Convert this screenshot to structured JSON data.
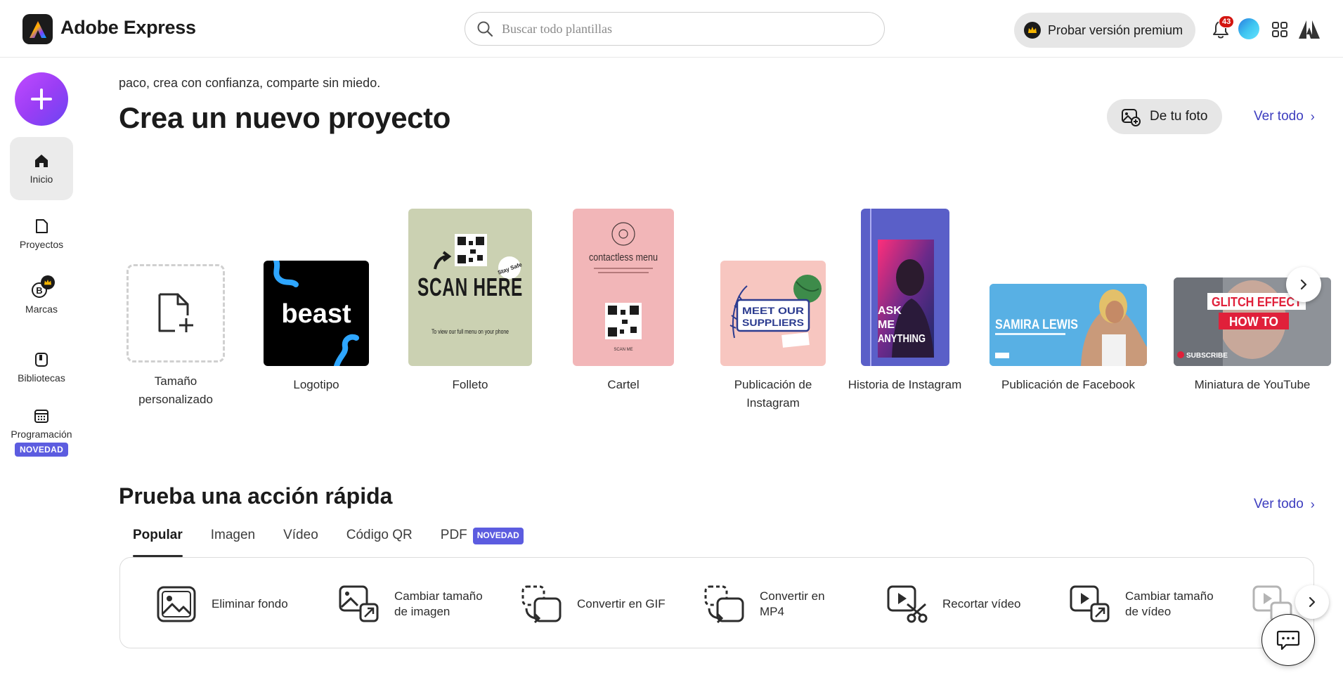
{
  "header": {
    "brand": "Adobe Express",
    "search_placeholder": "Buscar todo plantillas",
    "premium_label": "Probar versión premium",
    "notification_count": "43"
  },
  "sidebar": {
    "items": [
      {
        "label": "Inicio"
      },
      {
        "label": "Proyectos"
      },
      {
        "label": "Marcas"
      },
      {
        "label": "Bibliotecas"
      },
      {
        "label": "Programación",
        "tag": "NOVEDAD"
      }
    ]
  },
  "main": {
    "greeting": "paco, crea con confianza, comparte sin miedo.",
    "title": "Crea un nuevo proyecto",
    "from_photo": "De tu foto",
    "view_all": "Ver todo",
    "cards": [
      {
        "label": "Tamaño personalizado"
      },
      {
        "label": "Logotipo",
        "text": "beast"
      },
      {
        "label": "Folleto",
        "text_big": "SCAN HERE",
        "text_small": "To view our full menu on your phone",
        "sticker": "Stay Safe"
      },
      {
        "label": "Cartel",
        "text": "contactless menu",
        "footer": "SCAN ME"
      },
      {
        "label": "Publicación de Instagram",
        "text": "MEET OUR SUPPLIERS"
      },
      {
        "label": "Historia de Instagram",
        "text": "ASK ME ANYTHING"
      },
      {
        "label": "Publicación de Facebook",
        "text": "SAMIRA LEWIS"
      },
      {
        "label": "Miniatura de YouTube",
        "text_1": "GLITCH EFFECT",
        "text_2": "HOW TO",
        "text_3": "SUBSCRIBE"
      }
    ]
  },
  "quick": {
    "title": "Prueba una acción rápida",
    "view_all": "Ver todo",
    "tabs": [
      {
        "label": "Popular"
      },
      {
        "label": "Imagen"
      },
      {
        "label": "Vídeo"
      },
      {
        "label": "Código QR"
      },
      {
        "label": "PDF",
        "tag": "NOVEDAD"
      }
    ],
    "actions": [
      {
        "label": "Eliminar fondo"
      },
      {
        "label": "Cambiar tamaño de imagen"
      },
      {
        "label": "Convertir en GIF"
      },
      {
        "label": "Convertir en MP4"
      },
      {
        "label": "Recortar vídeo"
      },
      {
        "label": "Cambiar tamaño de vídeo"
      }
    ]
  },
  "colors": {
    "accent": "#3d3dbf",
    "new_tag": "#5c5ce0",
    "create_gradient_start": "#c04bff",
    "create_gradient_end": "#6a45f2"
  }
}
